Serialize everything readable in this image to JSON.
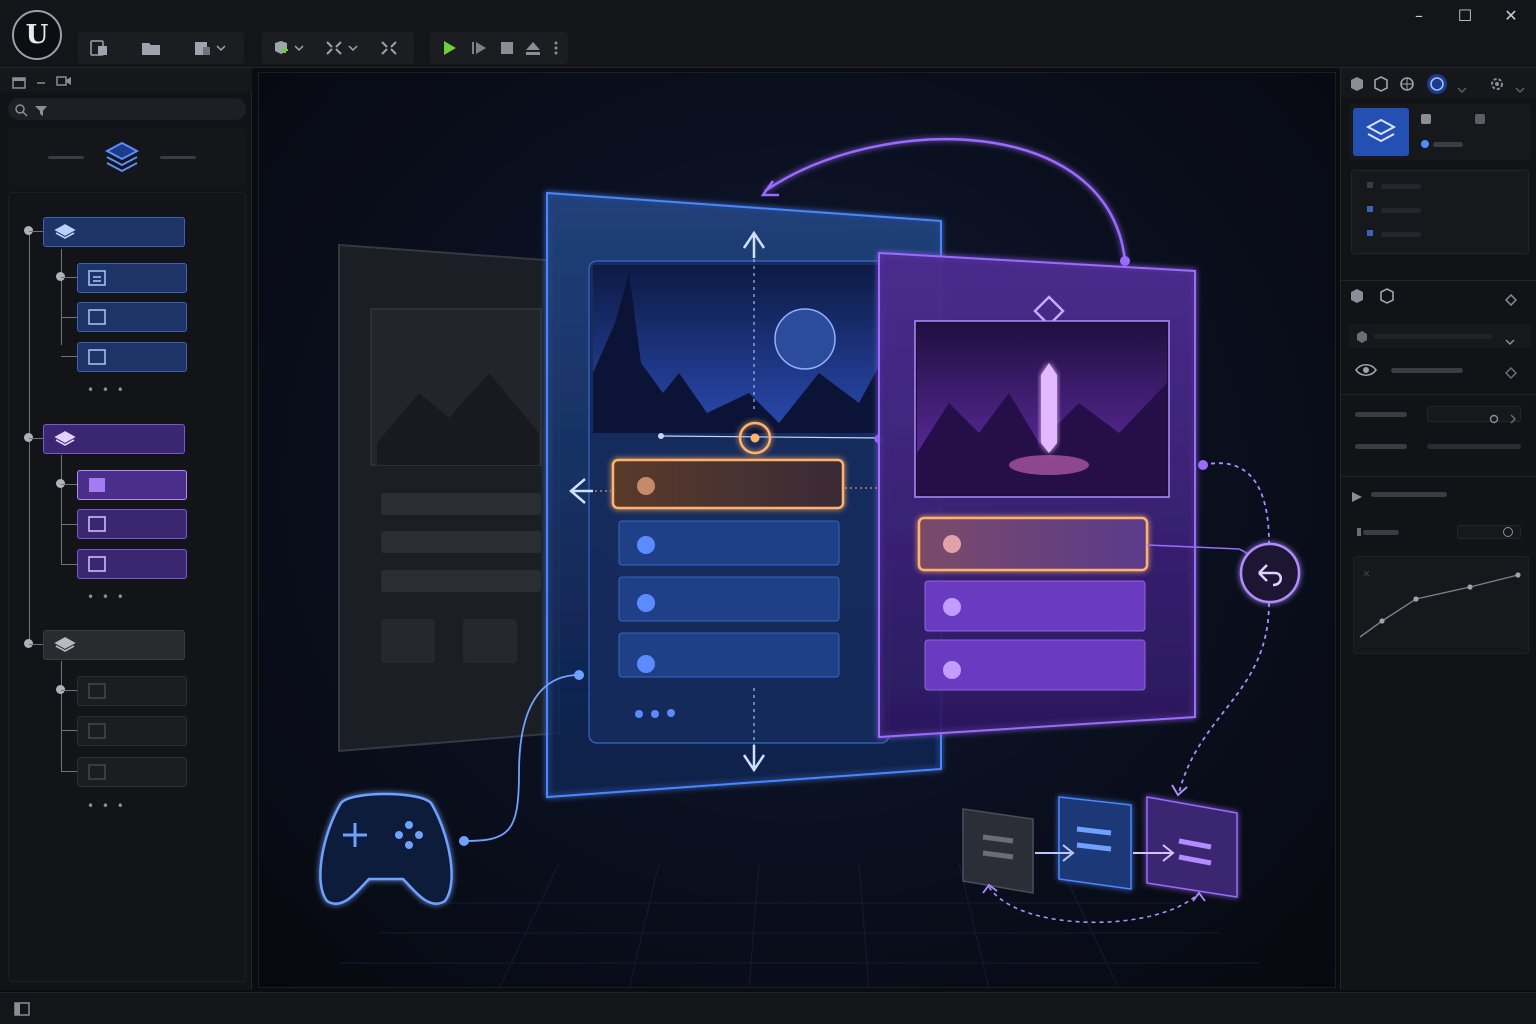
{
  "app": {
    "logo_text": "U",
    "window_controls": [
      "–",
      "☐",
      "✕"
    ]
  },
  "toolbar": {
    "play_icon": "play-icon",
    "step_icon": "step-icon",
    "stop_icon": "stop-icon",
    "eject_icon": "eject-icon"
  },
  "outliner": {
    "more_labels": [
      "• • •",
      "• • •",
      "• • •"
    ]
  },
  "colors": {
    "accent_blue": "#4d8dff",
    "accent_purple": "#9b6bff",
    "accent_orange": "#ffb36b",
    "play_green": "#6fcf3a"
  }
}
